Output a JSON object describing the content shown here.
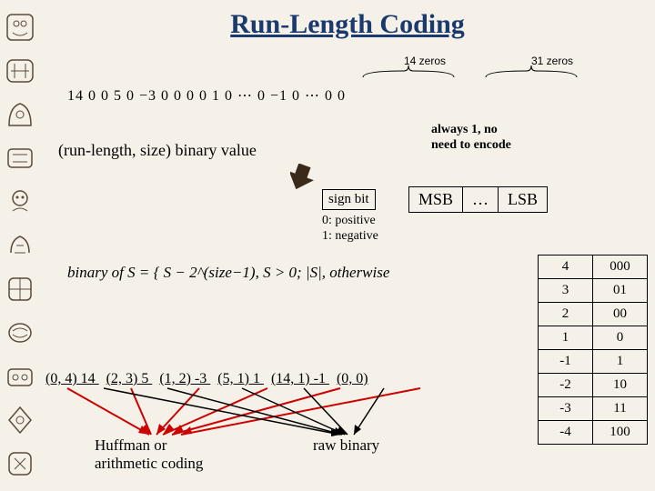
{
  "title": "Run-Length Coding",
  "braces": {
    "z14": "14  zeros",
    "z31": "31  zeros"
  },
  "sequence": "14   0   0   5   0   −3   0   0   0   0   1   0  ⋯  0   −1   0  ⋯  0   0",
  "formula_label": "(run-length, size) binary value",
  "always1": {
    "l1": "always 1, no",
    "l2": "need to encode"
  },
  "signbit": "sign bit",
  "signnote": {
    "l1": "0: positive",
    "l2": "1: negative"
  },
  "msb": "MSB",
  "dots": "…",
  "lsb": "LSB",
  "binary_formula": "binary of S = { S − 2^(size−1),   S > 0;   |S|,   otherwise",
  "table": [
    [
      "4",
      "000"
    ],
    [
      "3",
      "01"
    ],
    [
      "2",
      "00"
    ],
    [
      "1",
      "0"
    ],
    [
      "-1",
      "1"
    ],
    [
      "-2",
      "10"
    ],
    [
      "-3",
      "11"
    ],
    [
      "-4",
      "100"
    ]
  ],
  "pairs": [
    "(0, 4) 14",
    "(2, 3) 5",
    "(1, 2) -3",
    "(5, 1) 1",
    "(14, 1) -1",
    "(0, 0)"
  ],
  "huffman": {
    "l1": "Huffman or",
    "l2": "arithmetic coding"
  },
  "rawbin": "raw binary"
}
